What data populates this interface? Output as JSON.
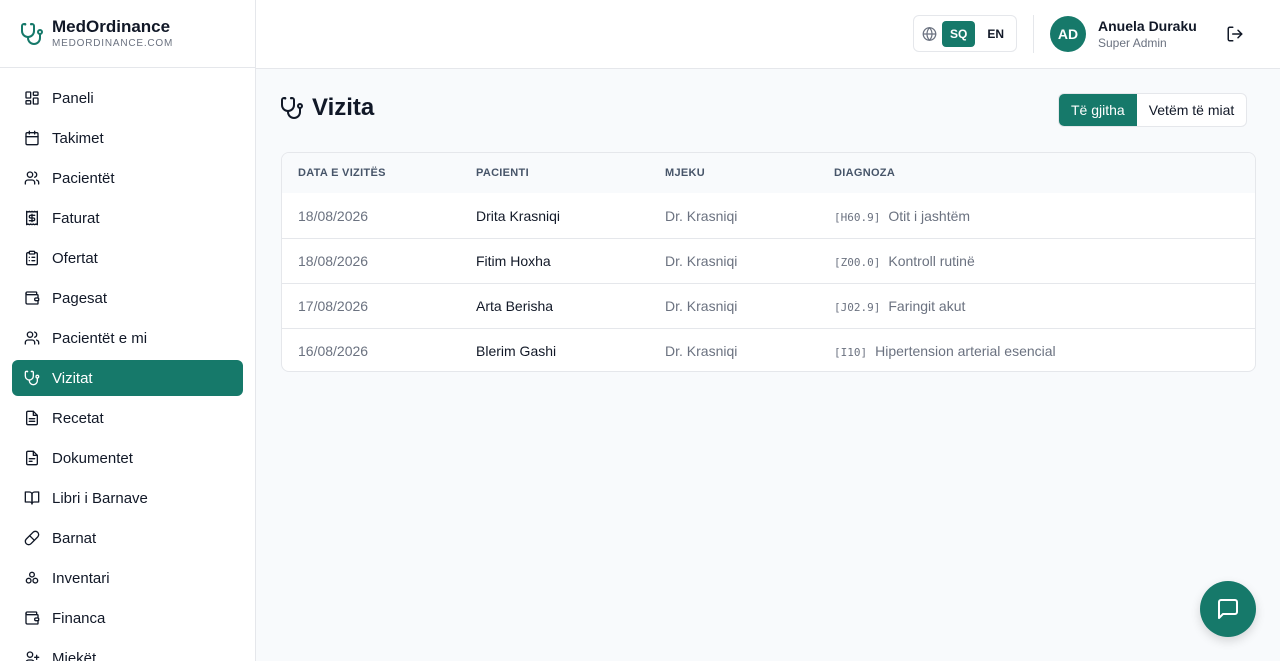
{
  "brand": {
    "name": "MedOrdinance",
    "domain": "MEDORDINANCE.COM"
  },
  "colors": {
    "accent": "#16796a",
    "sidebar_bg": "#ffffff",
    "page_bg": "#f8fafc"
  },
  "sidebar": {
    "items": [
      {
        "label": "Paneli",
        "icon": "dashboard-grid-icon",
        "active": false
      },
      {
        "label": "Takimet",
        "icon": "calendar-icon",
        "active": false
      },
      {
        "label": "Pacientët",
        "icon": "users-icon",
        "active": false
      },
      {
        "label": "Faturat",
        "icon": "invoice-icon",
        "active": false
      },
      {
        "label": "Ofertat",
        "icon": "clipboard-icon",
        "active": false
      },
      {
        "label": "Pagesat",
        "icon": "wallet-icon",
        "active": false
      },
      {
        "label": "Pacientët e mi",
        "icon": "users-icon",
        "active": false
      },
      {
        "label": "Vizitat",
        "icon": "stethoscope-icon",
        "active": true
      },
      {
        "label": "Recetat",
        "icon": "file-text-icon",
        "active": false
      },
      {
        "label": "Dokumentet",
        "icon": "file-icon",
        "active": false
      },
      {
        "label": "Libri i Barnave",
        "icon": "book-open-icon",
        "active": false
      },
      {
        "label": "Barnat",
        "icon": "pill-icon",
        "active": false
      },
      {
        "label": "Inventari",
        "icon": "boxes-icon",
        "active": false
      },
      {
        "label": "Financa",
        "icon": "wallet-icon",
        "active": false
      },
      {
        "label": "Mjekët",
        "icon": "user-doctor-icon",
        "active": false
      }
    ]
  },
  "topbar": {
    "languages": [
      {
        "code": "SQ",
        "active": true
      },
      {
        "code": "EN",
        "active": false
      }
    ],
    "user": {
      "initials": "AD",
      "name": "Anuela Duraku",
      "role": "Super Admin"
    }
  },
  "page": {
    "title": "Vizita",
    "filters": [
      {
        "label": "Të gjitha",
        "active": true
      },
      {
        "label": "Vetëm të miat",
        "active": false
      }
    ]
  },
  "table": {
    "headers": [
      "DATA E VIZITËS",
      "PACIENTI",
      "MJEKU",
      "DIAGNOZA"
    ],
    "rows": [
      {
        "date": "18/08/2026",
        "patient": "Drita Krasniqi",
        "doctor": "Dr. Krasniqi",
        "code": "[H60.9]",
        "diagnosis": "Otit i jashtëm"
      },
      {
        "date": "18/08/2026",
        "patient": "Fitim Hoxha",
        "doctor": "Dr. Krasniqi",
        "code": "[Z00.0]",
        "diagnosis": "Kontroll rutinë"
      },
      {
        "date": "17/08/2026",
        "patient": "Arta Berisha",
        "doctor": "Dr. Krasniqi",
        "code": "[J02.9]",
        "diagnosis": "Faringit akut"
      },
      {
        "date": "16/08/2026",
        "patient": "Blerim Gashi",
        "doctor": "Dr. Krasniqi",
        "code": "[I10]",
        "diagnosis": "Hipertension arterial esencial"
      }
    ]
  }
}
